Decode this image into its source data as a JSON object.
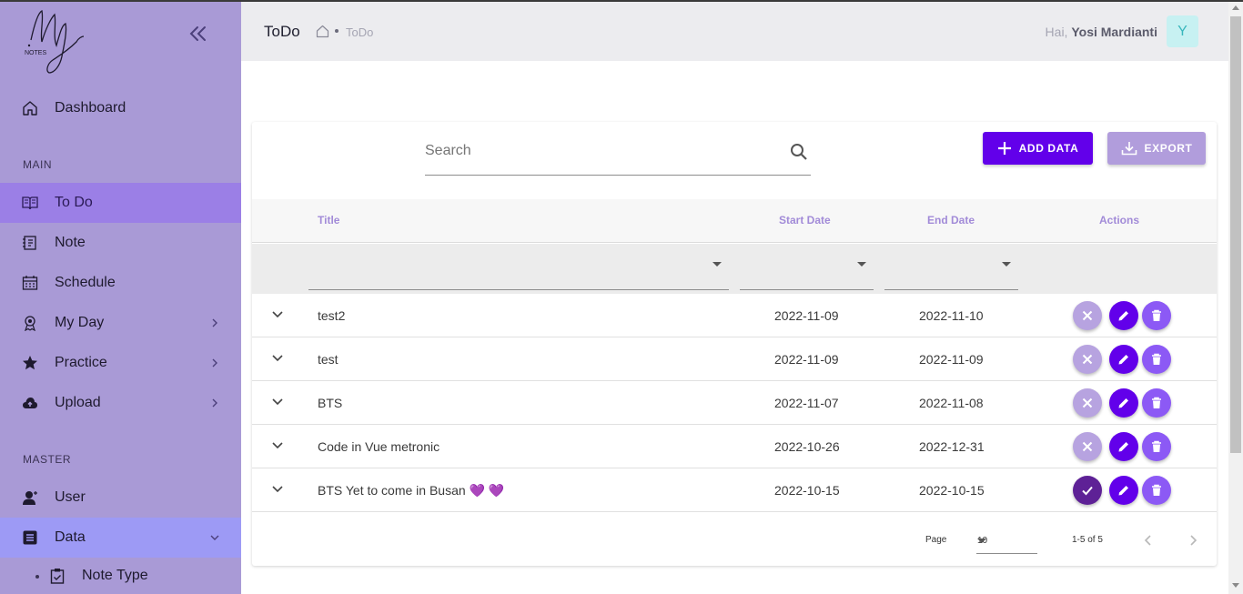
{
  "sidebar": {
    "logo_text": "My NOTES",
    "items": [
      {
        "label": "Dashboard",
        "icon": "home-icon"
      },
      {
        "label": "To Do",
        "icon": "book-open-icon"
      },
      {
        "label": "Note",
        "icon": "notebook-icon"
      },
      {
        "label": "Schedule",
        "icon": "calendar-icon"
      },
      {
        "label": "My Day",
        "icon": "award-icon"
      },
      {
        "label": "Practice",
        "icon": "star-icon"
      },
      {
        "label": "Upload",
        "icon": "cloud-upload-icon"
      },
      {
        "label": "User",
        "icon": "user-icon"
      },
      {
        "label": "Data",
        "icon": "list-box-icon"
      }
    ],
    "section_main": "MAIN",
    "section_master": "MASTER",
    "sub_item": {
      "label": "Note Type",
      "icon": "clipboard-icon"
    }
  },
  "header": {
    "title": "ToDo",
    "breadcrumb": "ToDo",
    "greeting": "Hai,",
    "user_name": "Yosi Mardianti",
    "avatar_letter": "Y"
  },
  "toolbar": {
    "search_placeholder": "Search",
    "add_label": "ADD DATA",
    "export_label": "EXPORT"
  },
  "table": {
    "columns": [
      "Title",
      "Start Date",
      "End Date",
      "Actions"
    ],
    "rows": [
      {
        "title": "test2",
        "start": "2022-11-09",
        "end": "2022-11-10",
        "done": false
      },
      {
        "title": "test",
        "start": "2022-11-09",
        "end": "2022-11-09",
        "done": false
      },
      {
        "title": "BTS",
        "start": "2022-11-07",
        "end": "2022-11-08",
        "done": false
      },
      {
        "title": "Code in Vue metronic",
        "start": "2022-10-26",
        "end": "2022-12-31",
        "done": false
      },
      {
        "title": "BTS Yet to come in Busan 💜 💜",
        "start": "2022-10-15",
        "end": "2022-10-15",
        "done": true
      }
    ]
  },
  "pagination": {
    "page_label": "Page",
    "per_page": "10",
    "range": "1-5 of 5"
  },
  "colors": {
    "sidebar": "#a99ad6",
    "active_item": "#9b7fe6",
    "primary": "#6200ea",
    "export": "#b19ddc"
  }
}
